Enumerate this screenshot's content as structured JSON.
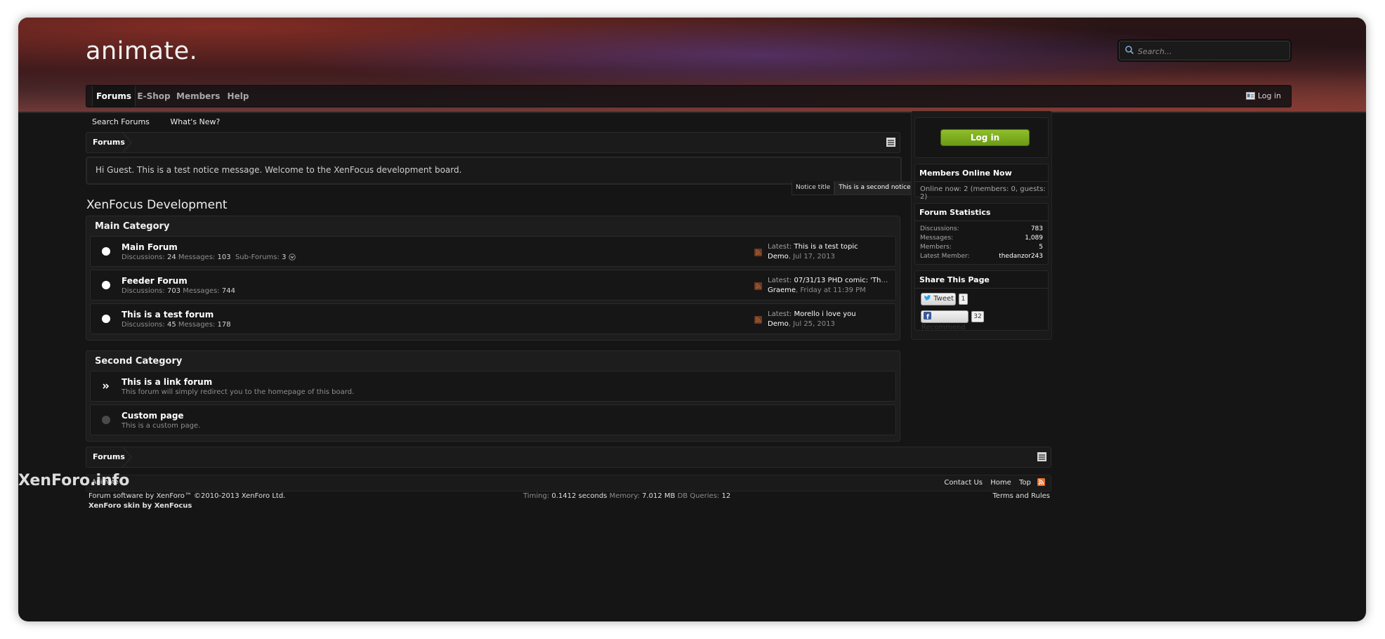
{
  "site": {
    "logo": "animate."
  },
  "search": {
    "placeholder": "Search..."
  },
  "nav": {
    "tabs": [
      {
        "label": "Forums",
        "active": true
      },
      {
        "label": "E-Shop"
      },
      {
        "label": "Members"
      },
      {
        "label": "Help"
      }
    ],
    "login": "Log in"
  },
  "subnav": {
    "items": [
      "Search Forums",
      "What's New?"
    ]
  },
  "breadcrumb": {
    "label": "Forums"
  },
  "notice": {
    "text": "Hi Guest. This is a test notice message. Welcome to the XenFocus development board.",
    "tabs": [
      "Notice title",
      "This is a second notice."
    ]
  },
  "board": {
    "title": "XenFocus Development"
  },
  "categories": [
    {
      "title": "Main Category",
      "forums": [
        {
          "name": "Main Forum",
          "discussions_label": "Discussions:",
          "discussions": "24",
          "messages_label": "Messages:",
          "messages": "103",
          "subforums_label": "Sub-Forums:",
          "subforums": "3",
          "latest_label": "Latest:",
          "latest_title": "This is a test topic",
          "latest_user": "Demo",
          "latest_date": "Jul 17, 2013"
        },
        {
          "name": "Feeder Forum",
          "discussions_label": "Discussions:",
          "discussions": "703",
          "messages_label": "Messages:",
          "messages": "744",
          "latest_label": "Latest:",
          "latest_title": "07/31/13 PHD comic: 'The...",
          "latest_user": "Graeme",
          "latest_date": "Friday at 11:39 PM"
        },
        {
          "name": "This is a test forum",
          "discussions_label": "Discussions:",
          "discussions": "45",
          "messages_label": "Messages:",
          "messages": "178",
          "latest_label": "Latest:",
          "latest_title": "Morello i love you",
          "latest_user": "Demo",
          "latest_date": "Jul 25, 2013"
        }
      ]
    },
    {
      "title": "Second Category",
      "forums": [
        {
          "name": "This is a link forum",
          "description": "This forum will simply redirect you to the homepage of this board."
        },
        {
          "name": "Custom page",
          "description": "This is a custom page."
        }
      ]
    }
  ],
  "sidebar": {
    "login_button": "Log in",
    "online": {
      "title": "Members Online Now",
      "text": "Online now: 2 (members: 0, guests: 2)"
    },
    "stats": {
      "title": "Forum Statistics",
      "rows": [
        {
          "label": "Discussions:",
          "value": "783"
        },
        {
          "label": "Messages:",
          "value": "1,089"
        },
        {
          "label": "Members:",
          "value": "5"
        },
        {
          "label": "Latest Member:",
          "value": "thedanzor243"
        }
      ]
    },
    "share": {
      "title": "Share This Page",
      "tweet_label": "Tweet",
      "tweet_count": "1",
      "recommend_label": "Recommend",
      "recommend_count": "32"
    }
  },
  "footer": {
    "breadcrumb": "Forums",
    "style_name": "Animate",
    "links": [
      "Contact Us",
      "Home",
      "Top"
    ],
    "copyright": "Forum software by XenForo™ ©2010-2013 XenForo Ltd.",
    "skin": "XenForo skin by XenFocus",
    "timing_label": "Timing:",
    "timing": "0.1412 seconds",
    "memory_label": "Memory:",
    "memory": "7.012 MB",
    "queries_label": "DB Queries:",
    "queries": "12",
    "terms": "Terms and Rules"
  },
  "watermark": "XenForo.info",
  "colors": {
    "accent_green": "#7aab1f",
    "rss_orange": "#e8722b",
    "background": "#151515"
  }
}
